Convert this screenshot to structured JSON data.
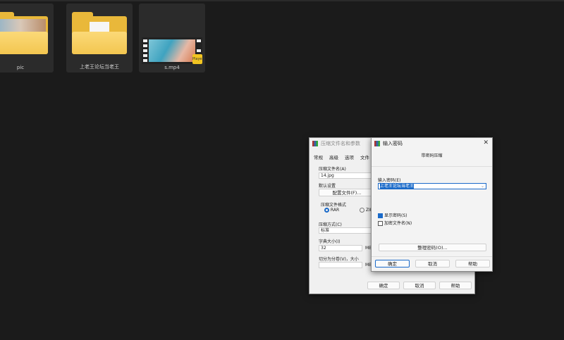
{
  "files": [
    {
      "name": "pic",
      "type": "folder-photo"
    },
    {
      "name": "上老王论坛当老王",
      "type": "folder-doc"
    },
    {
      "name": "s.mp4",
      "type": "video",
      "badge": "Player"
    }
  ],
  "archive_dialog": {
    "title": "压缩文件名和参数",
    "tabs": [
      "常规",
      "高级",
      "选项",
      "文件"
    ],
    "archive_name_label": "压缩文件名(A)",
    "archive_name": "14.jpg",
    "default_settings_label": "默认设置",
    "profiles_button": "配置文件(F)...",
    "format_label": "压缩文件格式",
    "format_options": [
      "RAR",
      "ZIP"
    ],
    "format_selected": "RAR",
    "method_label": "压缩方式(C)",
    "method_value": "标准",
    "dict_label": "字典大小(I)",
    "dict_value": "32",
    "dict_unit": "MB",
    "split_label": "切分为分卷(V)，大小",
    "split_unit": "MB",
    "ok": "确定",
    "cancel": "取消",
    "help": "帮助"
  },
  "password_dialog": {
    "title": "输入密码",
    "subtitle": "带密码压缩",
    "password_label": "输入密码(E)",
    "password_value": "上老王论坛当老王",
    "show_password": "显示密码(S)",
    "show_password_checked": true,
    "encrypt_names": "加密文件名(N)",
    "encrypt_names_checked": false,
    "organize_button": "整理密码(O)...",
    "ok": "确定",
    "cancel": "取消",
    "help": "帮助"
  }
}
